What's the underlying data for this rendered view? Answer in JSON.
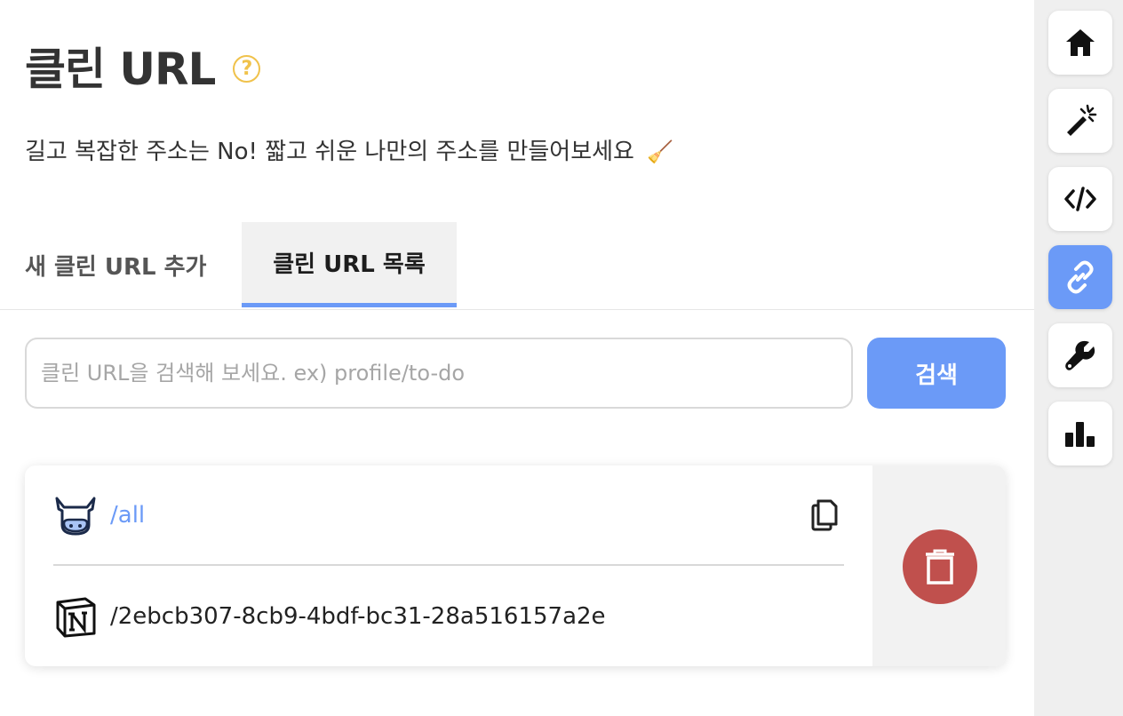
{
  "header": {
    "title": "클린 URL",
    "help_glyph": "?",
    "subtitle": "길고 복잡한 주소는 No! 짧고 쉬운 나만의 주소를 만들어보세요",
    "subtitle_emoji": "🧹"
  },
  "tabs": [
    {
      "label": "새 클린 URL 추가",
      "active": false
    },
    {
      "label": "클린 URL 목록",
      "active": true
    }
  ],
  "search": {
    "placeholder": "클린 URL을 검색해 보세요. ex) profile/to-do",
    "value": "",
    "button_label": "검색"
  },
  "entries": [
    {
      "icon": "cow-icon",
      "path": "/all",
      "is_link": true
    },
    {
      "icon": "notion-icon",
      "path": "/2ebcb307-8cb9-4bdf-bc31-28a516157a2e",
      "is_link": false
    }
  ],
  "sidebar": [
    {
      "icon": "home-icon",
      "active": false
    },
    {
      "icon": "magic-wand-icon",
      "active": false
    },
    {
      "icon": "code-icon",
      "active": false
    },
    {
      "icon": "link-icon",
      "active": true
    },
    {
      "icon": "wrench-icon",
      "active": false
    },
    {
      "icon": "bar-chart-icon",
      "active": false
    }
  ],
  "colors": {
    "accent": "#6b9af7",
    "delete": "#c0504d",
    "help": "#f0c24b",
    "sidebar_bg": "#efefef"
  }
}
